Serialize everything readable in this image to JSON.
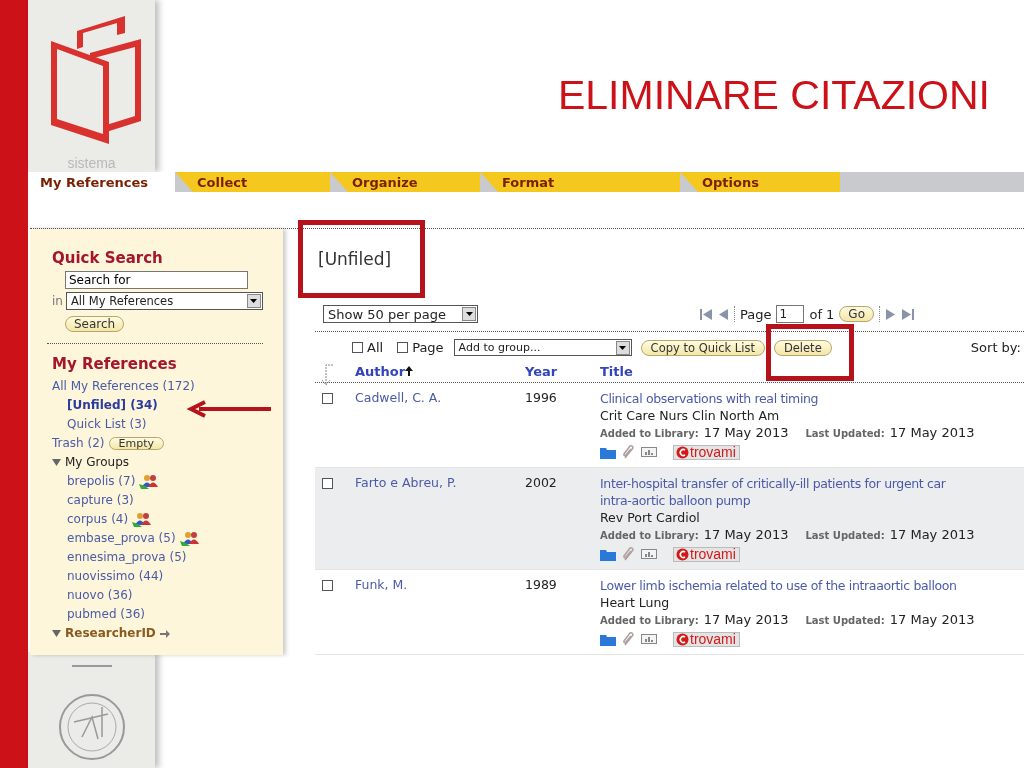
{
  "slide": {
    "title": "ELIMINARE CITAZIONI",
    "brand_text": "sistema"
  },
  "tabs": [
    {
      "label": "My References",
      "selected": true
    },
    {
      "label": "Collect",
      "selected": false
    },
    {
      "label": "Organize",
      "selected": false
    },
    {
      "label": "Format",
      "selected": false
    },
    {
      "label": "Options",
      "selected": false
    }
  ],
  "sidebar": {
    "quick_search": {
      "title": "Quick Search",
      "search_value": "Search for",
      "scope_label": "in",
      "scope": "All My References",
      "button": "Search"
    },
    "my_references": {
      "title": "My References",
      "items": [
        {
          "label": "All My References (172)",
          "selected": false,
          "children": [
            {
              "label": "[Unfiled] (34)",
              "selected": true
            },
            {
              "label": "Quick List (3)",
              "selected": false
            }
          ]
        },
        {
          "label": "Trash (2)",
          "selected": false,
          "button": "Empty"
        }
      ]
    },
    "groups": {
      "label": "My Groups",
      "expanded": true,
      "items": [
        {
          "label": "brepolis (7)",
          "shared": true
        },
        {
          "label": "capture (3)",
          "shared": false
        },
        {
          "label": "corpus (4)",
          "shared": true
        },
        {
          "label": "embase_prova (5)",
          "shared": true
        },
        {
          "label": "ennesima_prova (5)",
          "shared": false
        },
        {
          "label": "nuovissimo (44)",
          "shared": false
        },
        {
          "label": "nuovo (36)",
          "shared": false
        },
        {
          "label": "pubmed (36)",
          "shared": false
        }
      ]
    },
    "researcher_id": {
      "label": "ResearcherID",
      "expanded": true
    }
  },
  "main": {
    "heading": "[Unfiled]",
    "page_size": "Show 50 per page",
    "pager": {
      "page_label": "Page",
      "page": "1",
      "of": "of 1",
      "go": "Go"
    },
    "toolbar": {
      "all_label": "All",
      "all_checked": false,
      "page_label": "Page",
      "page_checked": false,
      "group_select": "Add to group...",
      "copy_button": "Copy to Quick List",
      "delete_button": "Delete",
      "sort_label": "Sort by:"
    },
    "columns": [
      {
        "label": "Author",
        "sorted": true
      },
      {
        "label": "Year",
        "sorted": false
      },
      {
        "label": "Title",
        "sorted": false
      }
    ],
    "rows": [
      {
        "checked": false,
        "author": "Cadwell, C. A.",
        "year": "1996",
        "title_lines": [
          "Clinical observations with real timing"
        ],
        "source": "Crit Care Nurs Clin North Am",
        "added_label": "Added to Library:",
        "added": "17 May 2013",
        "updated_label": "Last Updated:",
        "updated": "17 May 2013",
        "badge": "trovami"
      },
      {
        "checked": false,
        "author": "Farto e Abreu, P.",
        "year": "2002",
        "title_lines": [
          "Inter-hospital transfer of critically-ill patients for urgent car",
          "intra-aortic balloon pump"
        ],
        "source": "Rev Port Cardiol",
        "added_label": "Added to Library:",
        "added": "17 May 2013",
        "updated_label": "Last Updated:",
        "updated": "17 May 2013",
        "badge": "trovami"
      },
      {
        "checked": false,
        "author": "Funk, M.",
        "year": "1989",
        "title_lines": [
          "Lower limb ischemia related to use of the intraaortic balloon"
        ],
        "source": "Heart Lung",
        "added_label": "Added to Library:",
        "added": "17 May 2013",
        "updated_label": "Last Updated:",
        "updated": "17 May 2013",
        "badge": "trovami"
      }
    ]
  }
}
